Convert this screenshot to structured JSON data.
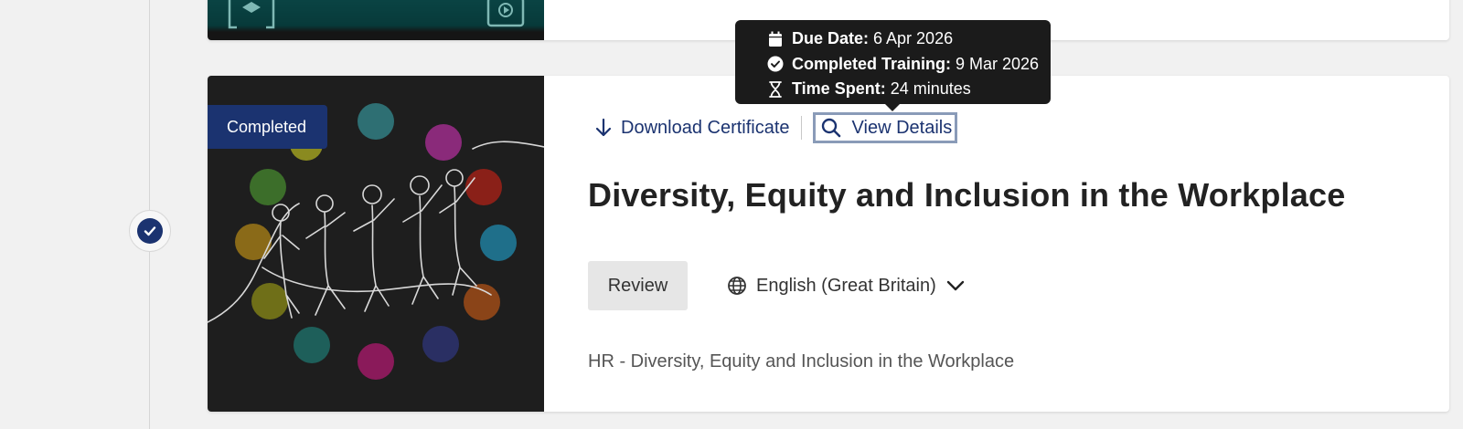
{
  "card": {
    "status_badge": "Completed",
    "actions": {
      "download_certificate": "Download Certificate",
      "view_details": "View Details"
    },
    "title": "Diversity, Equity and Inclusion in the Workplace",
    "review_button": "Review",
    "language": "English (Great Britain)",
    "subtitle": "HR - Diversity, Equity and Inclusion in the Workplace"
  },
  "tooltip": {
    "due_date_label": "Due Date:",
    "due_date_value": "6 Apr 2026",
    "completed_label": "Completed Training:",
    "completed_value": "9 Mar 2026",
    "time_spent_label": "Time Spent:",
    "time_spent_value": "24 minutes"
  },
  "icons": {
    "status": "check-circle-icon",
    "download": "arrow-down-icon",
    "view_details": "search-icon",
    "language": "globe-icon",
    "language_dropdown": "chevron-down-icon",
    "due_date": "calendar-icon",
    "completed": "check-circle-icon",
    "time_spent": "hourglass-icon"
  },
  "colors": {
    "accent": "#1b3370",
    "tooltip_bg": "#1b1b1b",
    "page_bg": "#f1f1f1",
    "review_bg": "#e6e6e6"
  }
}
